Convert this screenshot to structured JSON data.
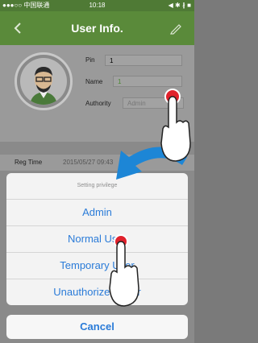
{
  "status_bar": {
    "carrier": "●●●○○ 中国联通",
    "time": "10:18",
    "icons": "◀ ✱ ∦ ■"
  },
  "nav": {
    "title": "User Info.",
    "back_icon": "chevron-left-icon",
    "edit_icon": "pencil-icon"
  },
  "fields": {
    "pin_label": "Pin",
    "pin_value": "1",
    "name_label": "Name",
    "name_value": "1",
    "authority_label": "Authority",
    "authority_value": "Admin"
  },
  "reg": {
    "label": "Reg Time",
    "value": "2015/05/27 09:43"
  },
  "sheet": {
    "title": "Setting privilege",
    "options": [
      "Admin",
      "Normal User",
      "Temporary User",
      "Unauthorized User"
    ],
    "cancel": "Cancel"
  },
  "colors": {
    "accent": "#2a7bd8",
    "nav": "#5a8a3a",
    "touch": "#e0212b"
  }
}
